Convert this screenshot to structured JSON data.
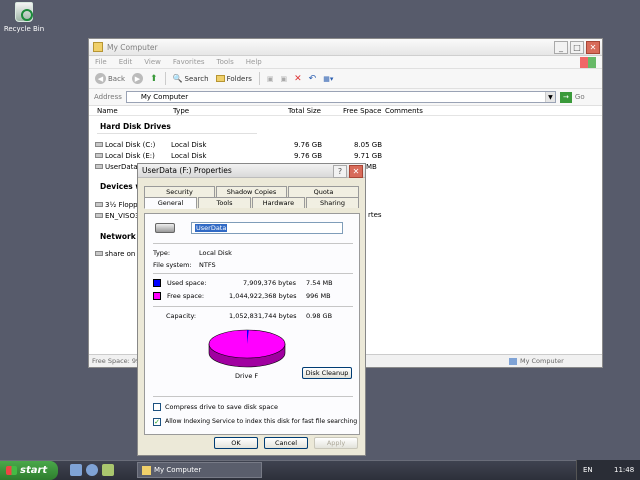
{
  "desktop": {
    "recycle_bin_label": "Recycle Bin"
  },
  "explorer": {
    "title": "My Computer",
    "menu": [
      "File",
      "Edit",
      "View",
      "Favorites",
      "Tools",
      "Help"
    ],
    "toolbar": {
      "back": "Back",
      "search": "Search",
      "folders": "Folders"
    },
    "address": {
      "label": "Address",
      "value": "My Computer",
      "go": "Go"
    },
    "columns": {
      "name": "Name",
      "type": "Type",
      "total_size": "Total Size",
      "free_space": "Free Space",
      "comments": "Comments"
    },
    "groups": {
      "hard_disk": "Hard Disk Drives",
      "devices": "Devices wi",
      "network": "Network D"
    },
    "drives": [
      {
        "name": "Local Disk (C:)",
        "type": "Local Disk",
        "total": "9.76 GB",
        "free": "8.05 GB"
      },
      {
        "name": "Local Disk (E:)",
        "type": "Local Disk",
        "total": "9.76 GB",
        "free": "9.71 GB"
      },
      {
        "name": "UserData",
        "free": "MB"
      }
    ],
    "devices": [
      {
        "name": "3½ Floppy"
      },
      {
        "name": "EN_VISO3",
        "extra": "rtes"
      }
    ],
    "network": [
      {
        "name": "share on 'r"
      }
    ],
    "status": {
      "left": "Free Space: 99",
      "right": "My Computer"
    }
  },
  "properties": {
    "title": "UserData (F:) Properties",
    "title_buttons": {
      "help": "?",
      "close": "✕"
    },
    "tabs_back": [
      "Security",
      "Shadow Copies",
      "Quota"
    ],
    "tabs_front": [
      "General",
      "Tools",
      "Hardware",
      "Sharing"
    ],
    "name_value": "UserData",
    "type_label": "Type:",
    "type_value": "Local Disk",
    "fs_label": "File system:",
    "fs_value": "NTFS",
    "used_label": "Used space:",
    "used_bytes": "7,909,376 bytes",
    "used_size": "7.54 MB",
    "free_label": "Free space:",
    "free_bytes": "1,044,922,368 bytes",
    "free_size": "996 MB",
    "capacity_label": "Capacity:",
    "capacity_bytes": "1,052,831,744 bytes",
    "capacity_size": "0.98 GB",
    "drive_label": "Drive F",
    "disk_cleanup": "Disk Cleanup",
    "compress_label": "Compress drive to save disk space",
    "index_label": "Allow Indexing Service to index this disk for fast file searching",
    "ok": "OK",
    "cancel": "Cancel",
    "apply": "Apply",
    "used_color": "#0000ff",
    "free_color": "#ff00ff",
    "used_fraction": 0.0075
  },
  "taskbar": {
    "start": "start",
    "task": "My Computer",
    "lang": "EN",
    "time": "11:48"
  }
}
